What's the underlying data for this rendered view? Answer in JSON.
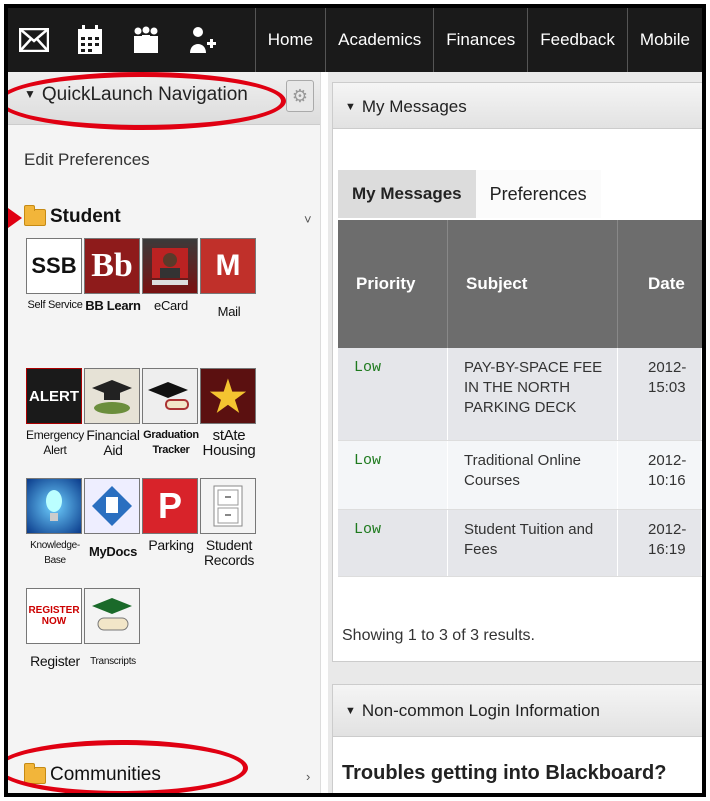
{
  "topbar": {
    "icons": [
      "mail-icon",
      "calendar-icon",
      "people-icon",
      "add-user-icon"
    ],
    "nav": [
      "Home",
      "Academics",
      "Finances",
      "Feedback",
      "Mobile"
    ]
  },
  "sidebar": {
    "title": "QuickLaunch Navigation",
    "edit_preferences": "Edit Preferences",
    "student_folder": "Student",
    "communities_folder": "Communities",
    "apps": [
      {
        "label": "Self Service",
        "tile_text": "SSB"
      },
      {
        "label": "BB Learn",
        "tile_text": "Bb"
      },
      {
        "label": "eCard",
        "tile_text": ""
      },
      {
        "label": "Mail",
        "tile_text": "M"
      },
      {
        "label": "Emergency Alert",
        "tile_text": "ALERT"
      },
      {
        "label": "Financial Aid",
        "tile_text": ""
      },
      {
        "label": "Graduation Tracker",
        "tile_text": ""
      },
      {
        "label": "stAte Housing",
        "tile_text": "★"
      },
      {
        "label": "Knowledge-Base",
        "tile_text": ""
      },
      {
        "label": "MyDocs",
        "tile_text": ""
      },
      {
        "label": "Parking",
        "tile_text": "P"
      },
      {
        "label": "Student Records",
        "tile_text": ""
      },
      {
        "label": "Register",
        "tile_text": "REGISTER NOW"
      },
      {
        "label": "Transcripts",
        "tile_text": ""
      }
    ]
  },
  "messages": {
    "panel_title": "My Messages",
    "tabs": [
      "My Messages",
      "Preferences"
    ],
    "columns": [
      "Priority",
      "Subject",
      "Date"
    ],
    "rows": [
      {
        "priority": "Low",
        "subject": "PAY-BY-SPACE FEE IN THE NORTH PARKING DECK",
        "date": "2012- 15:03"
      },
      {
        "priority": "Low",
        "subject": "Traditional Online Courses",
        "date": "2012- 10:16"
      },
      {
        "priority": "Low",
        "subject": "Student Tuition and Fees",
        "date": "2012- 16:19"
      }
    ],
    "result_text": "Showing 1 to 3 of 3 results."
  },
  "login_info": {
    "panel_title": "Non-common Login Information",
    "heading": "Troubles getting into Blackboard?"
  },
  "colors": {
    "annotation": "#e00012",
    "topbar": "#1a1a1a",
    "priority": "#1e7a1e"
  }
}
